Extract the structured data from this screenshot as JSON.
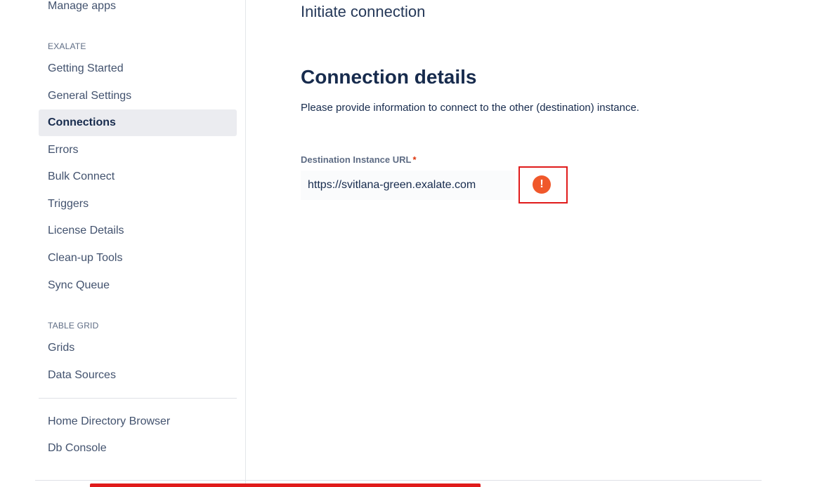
{
  "sidebar": {
    "top_item": "Manage apps",
    "sections": [
      {
        "heading": "EXALATE",
        "items": [
          {
            "label": "Getting Started"
          },
          {
            "label": "General Settings"
          },
          {
            "label": "Connections",
            "active": true
          },
          {
            "label": "Errors"
          },
          {
            "label": "Bulk Connect"
          },
          {
            "label": "Triggers"
          },
          {
            "label": "License Details"
          },
          {
            "label": "Clean-up Tools"
          },
          {
            "label": "Sync Queue"
          }
        ]
      },
      {
        "heading": "TABLE GRID",
        "items": [
          {
            "label": "Grids"
          },
          {
            "label": "Data Sources"
          }
        ]
      }
    ],
    "bottom_items": [
      {
        "label": "Home Directory Browser"
      },
      {
        "label": "Db Console"
      }
    ]
  },
  "main": {
    "page_title": "Initiate connection",
    "section_title": "Connection details",
    "section_description": "Please provide information to connect to the other (destination) instance.",
    "field": {
      "label": "Destination Instance URL",
      "required_mark": "*",
      "value": "https://svitlana-green.exalate.com",
      "error_icon": "exclamation-circle-icon",
      "error_glyph": "!"
    }
  },
  "colors": {
    "active_item_bg": "#ebecf0",
    "error_icon": "#f0582b",
    "highlight_border": "#e01b1b",
    "required_mark": "#de350b"
  }
}
